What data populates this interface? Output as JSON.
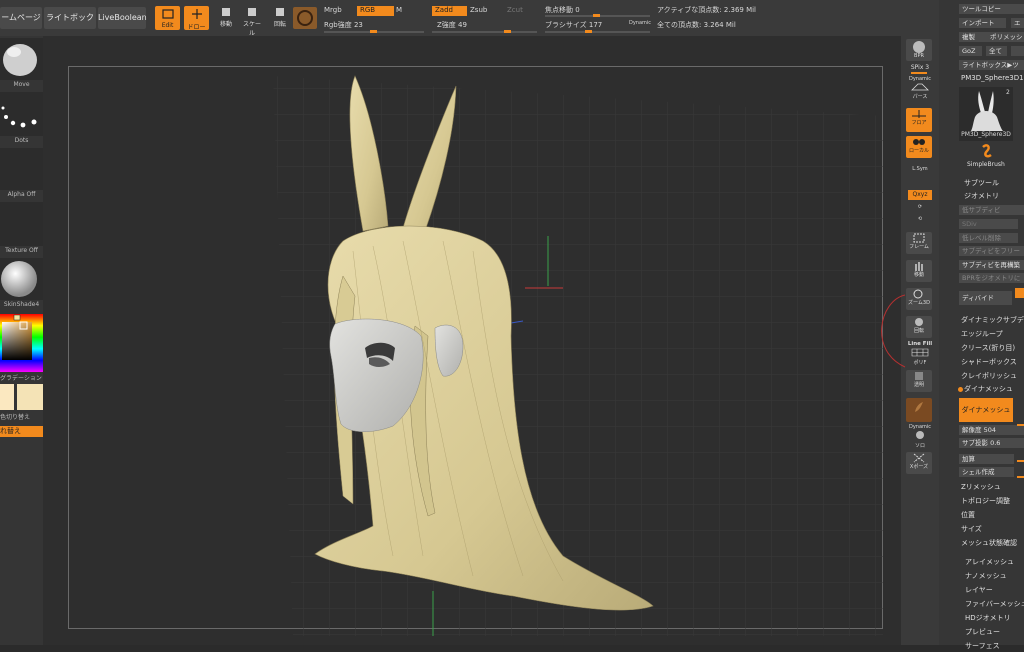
{
  "top_menu": {
    "home_label": "ームページ",
    "lightbox_label": "ライトボックス",
    "liveboolean_label": "LiveBoolean",
    "edit_label": "Edit",
    "draw_label": "ドロー",
    "move_label": "移動",
    "scale_label": "スケール",
    "rotate_label": "回転",
    "mrgb_label": "Mrgb",
    "rgb_label": "RGB",
    "m_label": "M",
    "rgb_intensity": "Rgb強度 23",
    "zadd_label": "Zadd",
    "zsub_label": "Zsub",
    "zcut_label": "Zcut",
    "z_intensity": "Z強度 49",
    "focal_shift": "焦点移動 0",
    "brush_size": "ブラシサイズ 177",
    "dynamic_label": "Dynamic",
    "active_points": "アクティブな頂点数: 2.369 Mil",
    "total_points": "全ての頂点数: 3.264 Mil"
  },
  "left_panel": {
    "brush_label": "Move",
    "stroke_label": "Dots",
    "alpha_label": "Alpha Off",
    "texture_label": "Texture Off",
    "material_label": "SkinShade4",
    "gradient_label": "グラデーション",
    "switch_color_label": "色切り替え",
    "alternate_label": "れ替え",
    "main_color": "#fbe8c0",
    "secondary_color": "#f4e3b6"
  },
  "right_shelf": {
    "bpr_label": "BPR",
    "spix_label": "SPix 3",
    "dynamic_label": "Dynamic",
    "perspective_label": "パース",
    "floor_label": "フロア",
    "local_label": "ローカル",
    "lsym_label": "L.Sym",
    "xyz_label": "Qxyz",
    "frame_label": "フレーム",
    "move_label": "移動",
    "zoom3d_label": "ズーム3D",
    "rotate_label": "回転",
    "linefill_label": "Line Fill",
    "polyf_label": "ポリF",
    "transp_label": "透明",
    "dynamic2_label": "Dynamic",
    "solo_label": "ソロ",
    "xpose_label": "Xポーズ"
  },
  "tool_tray": {
    "tool_copy": "ツールコピー",
    "import": "インポート",
    "export": "エ",
    "clone": "複製",
    "polymesh": "ポリメッシ",
    "goz": "GoZ",
    "all": "全て",
    "lightbox_tools": "ライトボックス▶ツ",
    "tool_name": "PM3D_Sphere3D1",
    "tool_thumb_label": "PM3D_Sphere3D",
    "tool_count": "2",
    "simplebrush_label": "SimpleBrush",
    "subtool": "サブツール",
    "geometry": "ジオメトリ",
    "lower_subdiv": "低サブディビ",
    "sdiv": "SDiv",
    "del_lower": "低レベル削除",
    "freeze_subdiv": "サブディビをフリー",
    "reconstruct_subdiv": "サブディビを再構築",
    "bpr_to_geo": "BPRをジオメトリに",
    "divide": "ディバイド",
    "dynamic_subdiv": "ダイナミックサブデ",
    "edge_loop": "エッジループ",
    "crease": "クリース(折り目)",
    "shadowbox": "シャドーボックス",
    "claypolish": "クレイポリッシュ",
    "dynamesh_header": "ダイナメッシュ",
    "dynamesh_button": "ダイナメッシュ",
    "resolution": "解像度 504",
    "sub_projection": "サブ投影 0.6",
    "add": "加算",
    "shell": "シェル作成",
    "zremesher": "Zリメッシュ",
    "topology": "トポロジー調整",
    "position": "位置",
    "size": "サイズ",
    "mesh_integrity": "メッシュ状態確認",
    "array_mesh": "アレイメッシュ",
    "nano_mesh": "ナノメッシュ",
    "layers": "レイヤー",
    "fibermesh": "ファイバーメッシュ",
    "hd_geometry": "HDジオメトリ",
    "preview": "プレビュー",
    "surface": "サーフェス"
  },
  "viewport": {
    "hair_color": "#dcd09a",
    "skin_color": "#cfcfcc"
  }
}
